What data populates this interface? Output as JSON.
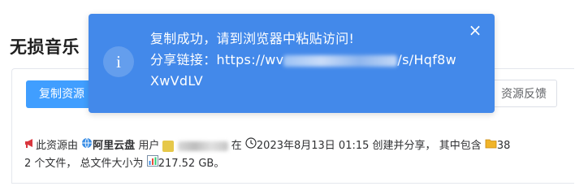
{
  "page": {
    "title": "无损音乐"
  },
  "card": {
    "copy_button": "复制资源",
    "feedback_button": "资源反馈",
    "info": {
      "prefix": "此资源由",
      "platform": "阿里云盘",
      "user_label": "用户",
      "at": "在",
      "datetime": "2023年8月13日 01:15",
      "created_text": "创建并分享，",
      "contains_text": "其中包含",
      "folder_count": "38",
      "file_count_text": "2 个文件，",
      "size_label": "总文件大小为",
      "size_value": "217.52 GB。"
    }
  },
  "toast": {
    "line1": "复制成功，请到浏览器中粘贴访问!",
    "label": "分享链接：",
    "link_start": "https://wv",
    "link_end": "/s/Hqf8w",
    "line3": "XwVdLV",
    "info_icon": "i",
    "close_icon": "×"
  },
  "colors": {
    "primary": "#409eff",
    "toast_bg": "#4389ea",
    "text": "#303133"
  },
  "icons": [
    "megaphone-icon",
    "globe-icon",
    "clock-icon",
    "folder-icon",
    "bar-chart-icon",
    "info-icon",
    "close-icon"
  ]
}
